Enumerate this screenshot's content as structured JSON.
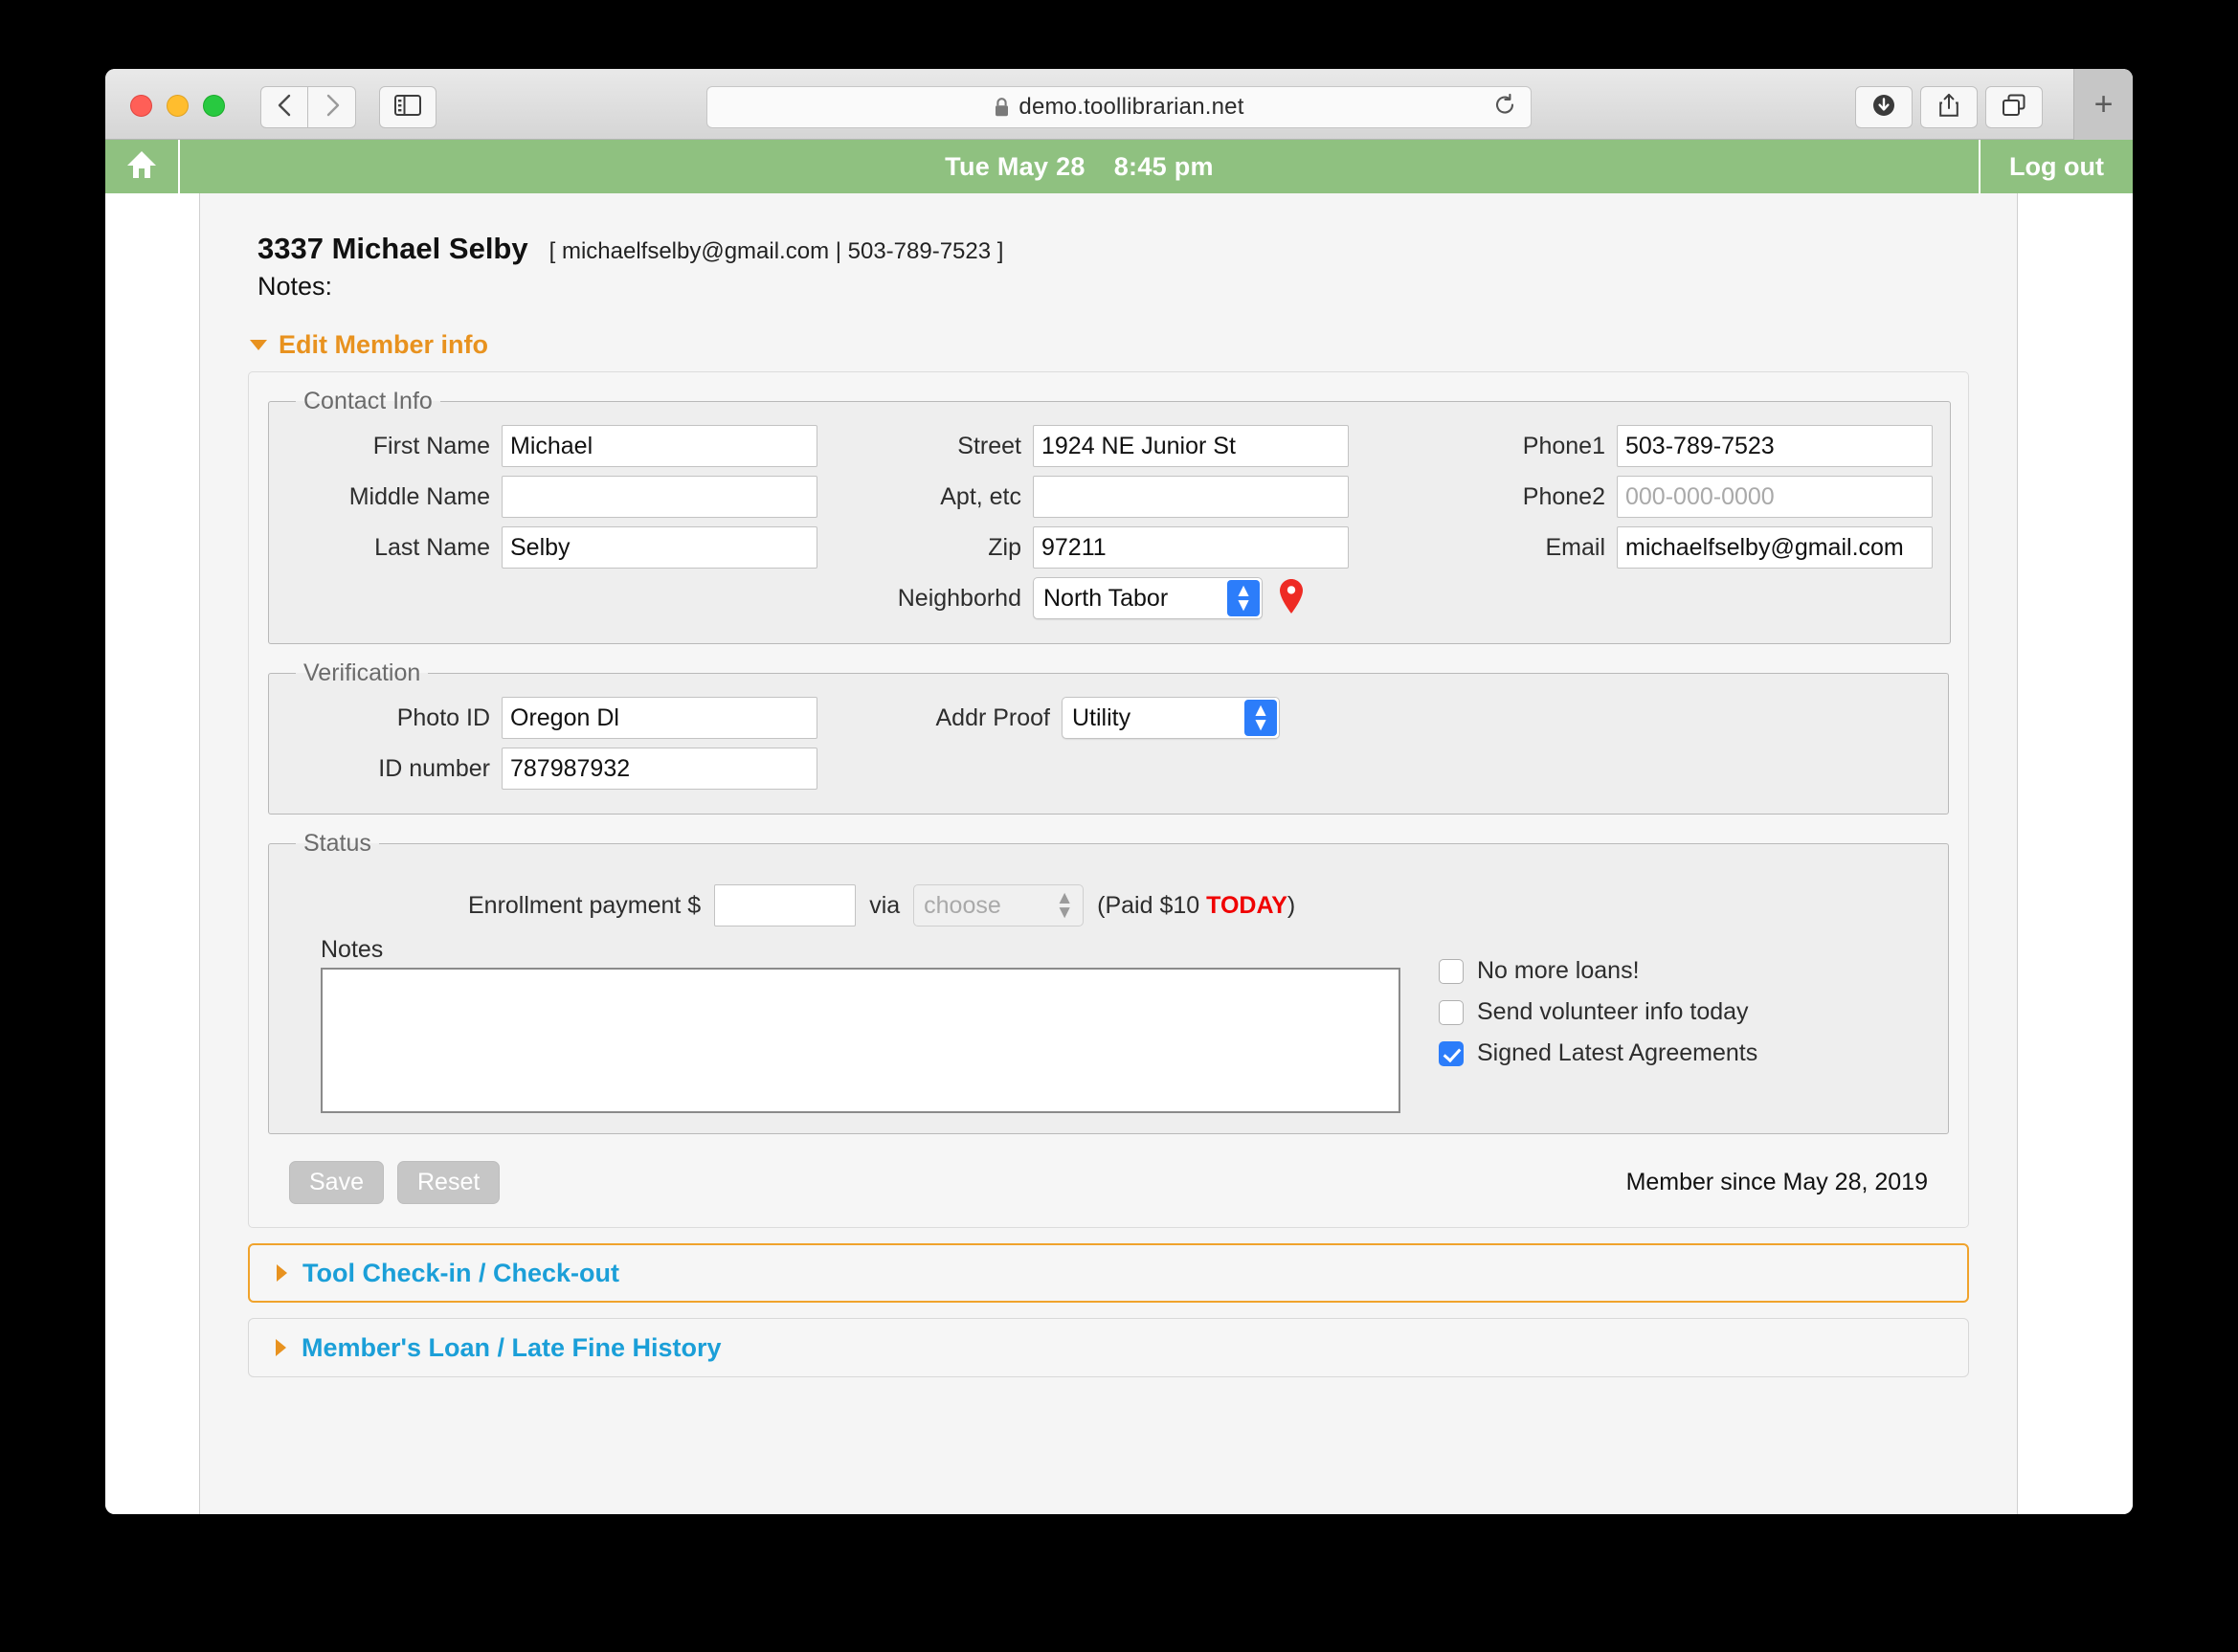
{
  "browser": {
    "url": "demo.toollibrarian.net",
    "lock_icon": "lock-icon",
    "reload_icon": "reload-icon",
    "back_icon": "chevron-left-icon",
    "forward_icon": "chevron-right-icon",
    "sidebar_icon": "sidebar-icon",
    "download_icon": "download-icon",
    "share_icon": "share-icon",
    "tabs_icon": "tab-overview-icon",
    "newtab_label": "+"
  },
  "appbar": {
    "home_icon": "home-icon",
    "date": "Tue May 28",
    "time": "8:45 pm",
    "logout_label": "Log out"
  },
  "member": {
    "id": "3337",
    "name": "Michael Selby",
    "title": "3337 Michael Selby",
    "contact_line": "[ michaelfselby@gmail.com | 503-789-7523 ]",
    "notes_label": "Notes:",
    "member_since": "Member since May 28, 2019"
  },
  "disclosure": {
    "edit_member_label": "Edit Member info"
  },
  "contact_info": {
    "legend": "Contact Info",
    "first_name_label": "First Name",
    "first_name_value": "Michael",
    "middle_name_label": "Middle Name",
    "middle_name_value": "",
    "last_name_label": "Last Name",
    "last_name_value": "Selby",
    "street_label": "Street",
    "street_value": "1924 NE Junior St",
    "apt_label": "Apt, etc",
    "apt_value": "",
    "zip_label": "Zip",
    "zip_value": "97211",
    "neighborhood_label": "Neighborhd",
    "neighborhood_value": "North Tabor",
    "map_pin_icon": "map-pin-icon",
    "phone1_label": "Phone1",
    "phone1_value": "503-789-7523",
    "phone2_label": "Phone2",
    "phone2_value": "",
    "phone2_placeholder": "000-000-0000",
    "email_label": "Email",
    "email_value": "michaelfselby@gmail.com"
  },
  "verification": {
    "legend": "Verification",
    "photo_id_label": "Photo ID",
    "photo_id_value": "Oregon Dl",
    "id_number_label": "ID number",
    "id_number_value": "787987932",
    "addr_proof_label": "Addr Proof",
    "addr_proof_value": "Utility"
  },
  "status": {
    "legend": "Status",
    "payment_label": "Enrollment payment $",
    "payment_value": "",
    "via_label": "via",
    "via_value": "choose",
    "paid_prefix": "(Paid $10 ",
    "paid_today": "TODAY",
    "paid_suffix": ")",
    "notes_label": "Notes",
    "notes_value": "",
    "checkboxes": [
      {
        "label": "No more loans!",
        "checked": false
      },
      {
        "label": "Send volunteer info today",
        "checked": false
      },
      {
        "label": "Signed Latest Agreements",
        "checked": true
      }
    ]
  },
  "buttons": {
    "save_label": "Save",
    "reset_label": "Reset"
  },
  "panels": [
    {
      "label": "Tool Check-in / Check-out"
    },
    {
      "label": "Member's Loan / Late Fine History"
    }
  ],
  "colors": {
    "appbar_green": "#8fc180",
    "accent_orange": "#e8921f",
    "panel_blue": "#1b9fd8",
    "today_red": "#f00000",
    "select_blue": "#2c7dfa"
  }
}
